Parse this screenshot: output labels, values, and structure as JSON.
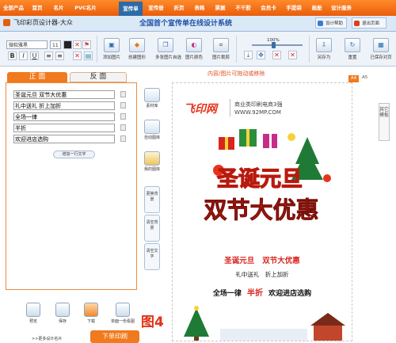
{
  "nav": [
    "全部产品",
    "首页",
    "名片",
    "PVC名片",
    "宣传单",
    "宣传册",
    "折页",
    "表格",
    "票据",
    "不干胶",
    "会员卡",
    "手提袋",
    "画册",
    "设计服务"
  ],
  "nav_active": 4,
  "app": {
    "title": "飞印彩页设计器-大众",
    "slogan": "全国首个宣传单在线设计系统",
    "help": "设计帮助",
    "close": "退出页面"
  },
  "toolbar": {
    "font": "微软雅黑",
    "size": "11",
    "tools": [
      {
        "label": "添加图片",
        "icon": "image-icon"
      },
      {
        "label": "创建图形",
        "icon": "shape-icon"
      },
      {
        "label": "多张图片自选",
        "icon": "multi-image-icon"
      },
      {
        "label": "图片颜色",
        "icon": "color-icon"
      },
      {
        "label": "图片裁剪",
        "icon": "crop-icon"
      },
      {
        "label": "另存为",
        "icon": "save-as-icon"
      },
      {
        "label": "重置",
        "icon": "reset-icon"
      },
      {
        "label": "已保存对页",
        "icon": "saved-icon"
      }
    ],
    "zoom": "100%"
  },
  "tabs": {
    "front": "正 面",
    "back": "反 面"
  },
  "text_rows": [
    "圣诞元旦   双节大优惠",
    "礼中送礼   折上加折",
    "全场一律",
    "半折",
    "欢迎进店选购"
  ],
  "add_row": "增加一行文字",
  "bottom": {
    "buttons": [
      "预览",
      "保存",
      "下载",
      "单面一份看图"
    ],
    "figure_label": "图4",
    "more": ">>更多设计名片",
    "order": "下单印刷"
  },
  "mid": {
    "materials": "素材库",
    "auto": "自动图库",
    "mine": "我的图库",
    "change_bg": "更换背景",
    "clear_bg": "清空背景",
    "clear_text": "清空文字"
  },
  "canvas": {
    "hint": "内容/图片可拖动或移除",
    "sizes": [
      "A4",
      "A5"
    ],
    "logo": "飞印网",
    "logo_sub": "商业类印刷电商3强",
    "url": "WWW.92MP.COM",
    "headline1": "圣诞元旦",
    "headline2": "双节大优惠",
    "line1": "圣诞元旦   双节大优惠",
    "line2": "礼中送礼   折上加折",
    "line3_a": "全场一律",
    "line3_b": "半折",
    "line3_c": "欢迎进店选购"
  },
  "template_tab": "其它模板"
}
